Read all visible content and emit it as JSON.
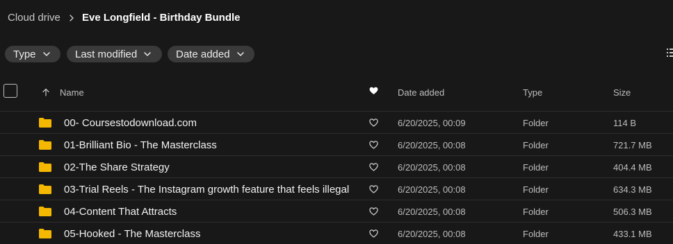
{
  "breadcrumb": {
    "root": "Cloud drive",
    "current": "Eve Longfield - Birthday Bundle"
  },
  "filters": [
    {
      "label": "Type"
    },
    {
      "label": "Last modified"
    },
    {
      "label": "Date added"
    }
  ],
  "table": {
    "headers": {
      "name": "Name",
      "date_added": "Date added",
      "type": "Type",
      "size": "Size"
    },
    "rows": [
      {
        "name": "00- Coursestodownload.com",
        "date_added": "6/20/2025, 00:09",
        "type": "Folder",
        "size": "114 B"
      },
      {
        "name": "01-Brilliant Bio - The Masterclass",
        "date_added": "6/20/2025, 00:08",
        "type": "Folder",
        "size": "721.7 MB"
      },
      {
        "name": "02-The Share Strategy",
        "date_added": "6/20/2025, 00:08",
        "type": "Folder",
        "size": "404.4 MB"
      },
      {
        "name": "03-Trial Reels - The Instagram growth feature that feels illegal",
        "date_added": "6/20/2025, 00:08",
        "type": "Folder",
        "size": "634.3 MB"
      },
      {
        "name": "04-Content That Attracts",
        "date_added": "6/20/2025, 00:08",
        "type": "Folder",
        "size": "506.3 MB"
      },
      {
        "name": "05-Hooked - The Masterclass",
        "date_added": "6/20/2025, 00:08",
        "type": "Folder",
        "size": "433.1 MB"
      }
    ]
  },
  "colors": {
    "background": "#181818",
    "chip": "#3a3a3a",
    "folder": "#f5b800"
  },
  "icons": {
    "breadcrumb_separator": "chevron-right-icon",
    "chip_dropdown": "chevron-down-icon",
    "sort": "arrow-up-icon",
    "favourite_header": "heart-filled-icon",
    "favourite_row": "heart-outline-icon",
    "folder": "folder-icon",
    "view_toggle": "list-view-icon"
  }
}
